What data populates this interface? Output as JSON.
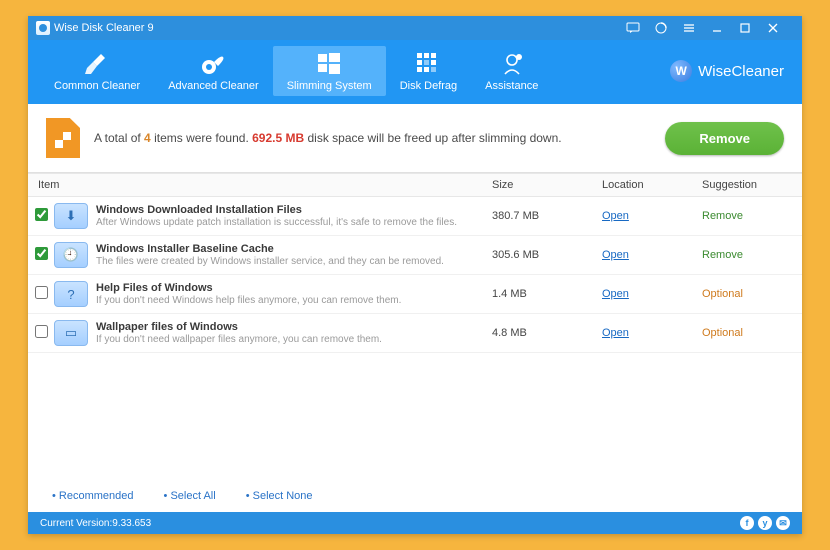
{
  "title": "Wise Disk Cleaner 9",
  "brand": "WiseCleaner",
  "toolbar": [
    {
      "label": "Common Cleaner",
      "selected": false
    },
    {
      "label": "Advanced Cleaner",
      "selected": false
    },
    {
      "label": "Slimming System",
      "selected": true
    },
    {
      "label": "Disk Defrag",
      "selected": false
    },
    {
      "label": "Assistance",
      "selected": false
    }
  ],
  "summary": {
    "prefix": "A total of ",
    "count": "4",
    "mid": " items were found. ",
    "size": "692.5 MB",
    "suffix": " disk space will be freed up after slimming down."
  },
  "remove_btn": "Remove",
  "columns": {
    "item": "Item",
    "size": "Size",
    "loc": "Location",
    "sugg": "Suggestion"
  },
  "open_label": "Open",
  "rows": [
    {
      "checked": true,
      "glyph": "⬇",
      "title": "Windows Downloaded Installation Files",
      "desc": "After Windows update patch installation is successful, it's safe to remove the files.",
      "size": "380.7 MB",
      "sugg": "Remove",
      "sclass": "remove"
    },
    {
      "checked": true,
      "glyph": "🕘",
      "title": "Windows Installer Baseline Cache",
      "desc": "The files were created by Windows installer service, and they can be removed.",
      "size": "305.6 MB",
      "sugg": "Remove",
      "sclass": "remove"
    },
    {
      "checked": false,
      "glyph": "?",
      "title": "Help Files of Windows",
      "desc": "If you don't need Windows help files anymore, you can remove them.",
      "size": "1.4 MB",
      "sugg": "Optional",
      "sclass": "optional"
    },
    {
      "checked": false,
      "glyph": "▭",
      "title": "Wallpaper files of Windows",
      "desc": "If you don't need wallpaper files anymore, you can remove them.",
      "size": "4.8 MB",
      "sugg": "Optional",
      "sclass": "optional"
    }
  ],
  "footer_links": [
    "Recommended",
    "Select All",
    "Select None"
  ],
  "status": "Current Version:9.33.653",
  "social": [
    "f",
    "y",
    "✉"
  ]
}
